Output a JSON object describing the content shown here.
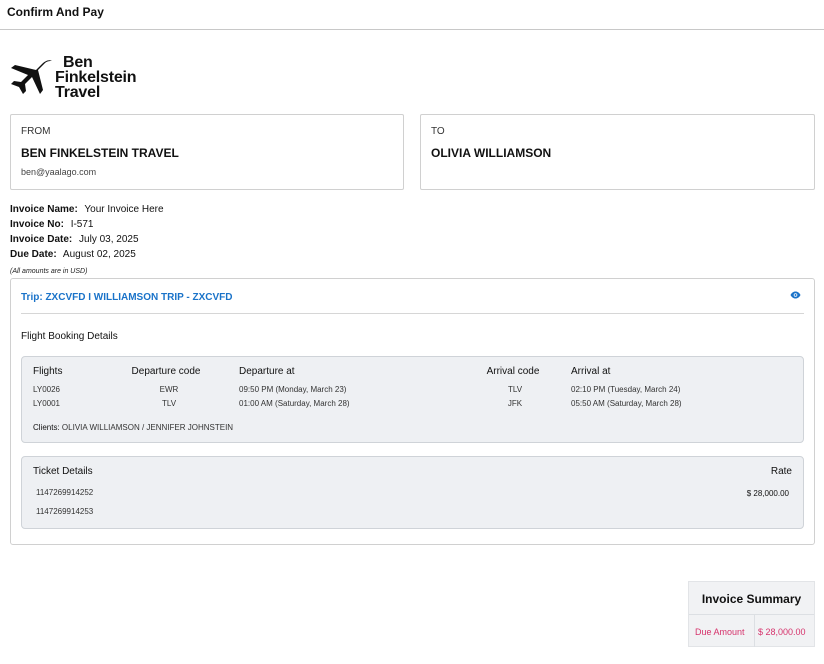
{
  "header": {
    "title": "Confirm And Pay"
  },
  "brand": {
    "line1": "Ben",
    "line2": "Finkelstein",
    "line3": "Travel"
  },
  "from": {
    "label": "FROM",
    "name": "BEN FINKELSTEIN TRAVEL",
    "email": "ben@yaalago.com"
  },
  "to": {
    "label": "TO",
    "name": "OLIVIA WILLIAMSON"
  },
  "invoice": {
    "name_label": "Invoice Name:",
    "name_value": "Your Invoice Here",
    "no_label": "Invoice No:",
    "no_value": "I-571",
    "date_label": "Invoice Date:",
    "date_value": "July 03, 2025",
    "due_label": "Due Date:",
    "due_value": "August 02, 2025",
    "currency_note": "(All amounts are in USD)"
  },
  "trip": {
    "title": "Trip: ZXCVFD I WILLIAMSON TRIP - ZXCVFD",
    "section_title": "Flight Booking Details",
    "columns": {
      "flights": "Flights",
      "dep_code": "Departure code",
      "dep_at": "Departure at",
      "arr_code": "Arrival code",
      "arr_at": "Arrival at"
    },
    "rows": [
      {
        "flight": "LY0026",
        "dep_code": "EWR",
        "dep_at": "09:50 PM (Monday, March 23)",
        "arr_code": "TLV",
        "arr_at": "02:10 PM (Tuesday, March 24)"
      },
      {
        "flight": "LY0001",
        "dep_code": "TLV",
        "dep_at": "01:00 AM (Saturday, March 28)",
        "arr_code": "JFK",
        "arr_at": "05:50 AM (Saturday, March 28)"
      }
    ],
    "clients_label": "Clients:",
    "clients_value": "OLIVIA WILLIAMSON / JENNIFER JOHNSTEIN",
    "tickets": {
      "header": "Ticket Details",
      "rate_header": "Rate",
      "numbers": [
        "1147269914252",
        "1147269914253"
      ],
      "rate": "$ 28,000.00"
    }
  },
  "summary": {
    "title": "Invoice Summary",
    "due_label": "Due Amount",
    "due_value": "$ 28,000.00"
  },
  "colors": {
    "link": "#1a73c9",
    "due": "#d6336c",
    "panel": "#eef0f3"
  },
  "icons": {
    "logo": "airplane-icon",
    "view": "eye-icon"
  }
}
